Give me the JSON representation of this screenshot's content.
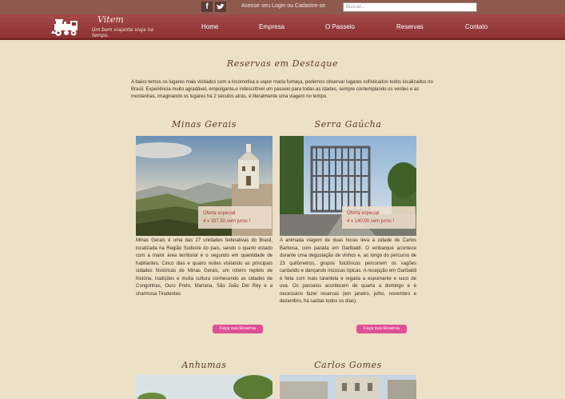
{
  "topbar": {
    "facebook_label": "f",
    "login_text": "Acesse seu Login ou Cadastre-se",
    "search_placeholder": "Buscar..."
  },
  "brand": {
    "name": "Vitem",
    "tagline": "Um bom viajante viaja no tempo."
  },
  "menu": {
    "items": [
      "Home",
      "Empresa",
      "O Passeio",
      "Reservas",
      "Contato"
    ]
  },
  "main": {
    "title": "Reservas em Destaque",
    "intro": "A baixo temos os lugares mais visitados com a locomotiva a vapor maria fumaça, podemos observar lugares sofisticados todos localizados no Brasil. Experiência muito agradável, empolgante,e indescritível um passeio para todas as idades, sempre contemplando os verdes e as montanhas, imaginando os lugares há 2 séculos atrás, é literalmente uma viagem no tempo."
  },
  "cards": [
    {
      "title": "Minas Gerais",
      "offer_label": "Oferta especial",
      "offer_price": "4 x 337,50 sem juros !",
      "text": "Minas Gerais é uma das 27 unidades federativas do Brasil, localizada na Região Sudeste do país, sendo o quarto estado com a maior área territorial e o segundo em quantidade de habitantes. Cinco dias e quatro noites visitando as principais cidades históricas de Minas Gerais, um roteiro repleto de história, tradições e muita cultura conhecendo as cidades de Congonhas, Ouro Preto, Mariana, São João Del Rey e a charmosa Tiradentes",
      "button": "Faça sua Reserva"
    },
    {
      "title": "Serra Gaúcha",
      "offer_label": "Oferta especial",
      "offer_price": "4 x 140,00 sem juros !",
      "text": "A animada viagem de duas horas leva à cidade de Carlos Barbosa, com parada em Garibaldi. O embarque acontece durante uma degustação de vinhos e, ao longo do percurso de 23 quilômetros, grupos folclóricos percorrem os vagões cantando e dançando músicas típicas. A recepção em Garibaldi é feita com mais tarantela e regada a espumante e suco de uva. Os passeios acontecem de quarta a domingo e é necessário fazer reservas (em janeiro, julho, novembro e dezembro, há saídas todos os dias).",
      "button": "Faça sua Reserva"
    },
    {
      "title": "Anhumas"
    },
    {
      "title": "Carlos Gomes"
    }
  ]
}
